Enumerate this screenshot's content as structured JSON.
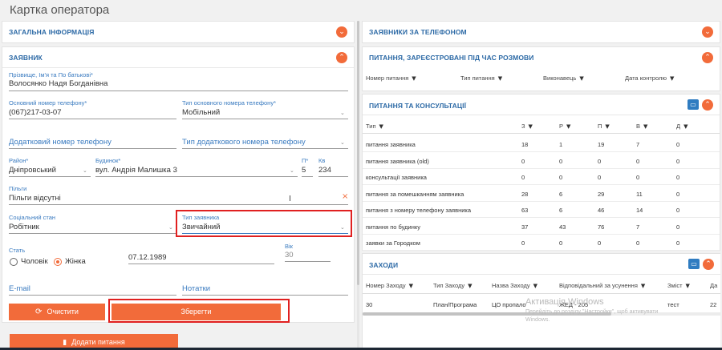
{
  "page": {
    "title": "Картка оператора"
  },
  "left": {
    "general": {
      "title": "ЗАГАЛЬНА ІНФОРМАЦІЯ"
    },
    "applicant": {
      "title": "ЗАЯВНИК",
      "name_label": "Прізвище, Ім'я та По батькові*",
      "name_value": "Волосянко Надя Богданівна",
      "phone_label": "Основний номер телефону*",
      "phone_value": "(067)217-03-07",
      "phone_type_label": "Тип основного номера телефону*",
      "phone_type_value": "Мобільний",
      "extra_phone_placeholder": "Додатковий номер телефону",
      "extra_phone_type_placeholder": "Тип додаткового номера телефону",
      "district_label": "Район*",
      "district_value": "Дніпровський",
      "building_label": "Будинок*",
      "building_value": "вул. Андрія Малишка 3",
      "entrance_label": "П*",
      "entrance_value": "5",
      "apt_label": "Кв",
      "apt_value": "234",
      "benefits_label": "Пільги",
      "benefits_value": "Пільги відсутні",
      "social_label": "Соціальний стан",
      "social_value": "Робітник",
      "type_label": "Тип заявника",
      "type_value": "Звичайний",
      "sex_label": "Стать",
      "male_label": "Чоловік",
      "female_label": "Жінка",
      "birth_value": "07.12.1989",
      "age_label": "Вік",
      "age_value": "30",
      "email_placeholder": "E-mail",
      "notes_placeholder": "Нотатки"
    },
    "buttons": {
      "clear": "Очистити",
      "save": "Зберегти",
      "add": "Додати питання"
    }
  },
  "right": {
    "callers": {
      "title": "ЗАЯВНИКИ ЗА ТЕЛЕФОНОМ"
    },
    "questions": {
      "title": "ПИТАННЯ, ЗАРЕЄСТРОВАНІ ПІД ЧАС РОЗМОВИ",
      "columns": [
        "Номер питання",
        "Тип питання",
        "Виконавець",
        "Дата контролю"
      ]
    },
    "consult": {
      "title": "ПИТАННЯ ТА КОНСУЛЬТАЦІЇ",
      "columns": [
        "Тип",
        "З",
        "Р",
        "П",
        "В",
        "Д"
      ],
      "rows": [
        [
          "питання заявника",
          "18",
          "1",
          "19",
          "7",
          "0"
        ],
        [
          "питання заявника (old)",
          "0",
          "0",
          "0",
          "0",
          "0"
        ],
        [
          "консультації заявника",
          "0",
          "0",
          "0",
          "0",
          "0"
        ],
        [
          "питання за помешканням заявника",
          "28",
          "6",
          "29",
          "11",
          "0"
        ],
        [
          "питання з номеру телефону заявника",
          "63",
          "6",
          "46",
          "14",
          "0"
        ],
        [
          "питання по будинку",
          "37",
          "43",
          "76",
          "7",
          "0"
        ],
        [
          "заявки за Городком",
          "0",
          "0",
          "0",
          "0",
          "0"
        ]
      ]
    },
    "events": {
      "title": "ЗАХОДИ",
      "columns": [
        "Номер Заходу",
        "Тип Заходу",
        "Назва Заходу",
        "Відповідальний за усунення",
        "Зміст",
        "Да"
      ],
      "row": [
        "30",
        "План/Програма",
        "ЦО пропало",
        "ЖЕД - 205",
        "тест",
        "22"
      ]
    }
  },
  "watermark": {
    "title": "Активація Windows",
    "line1": "Перейдіть до розділу \"Настройки\", щоб активувати",
    "line2": "Windows."
  },
  "colors": {
    "accent": "#f26b3a",
    "link": "#2d6aa6",
    "highlight": "#e02020"
  }
}
